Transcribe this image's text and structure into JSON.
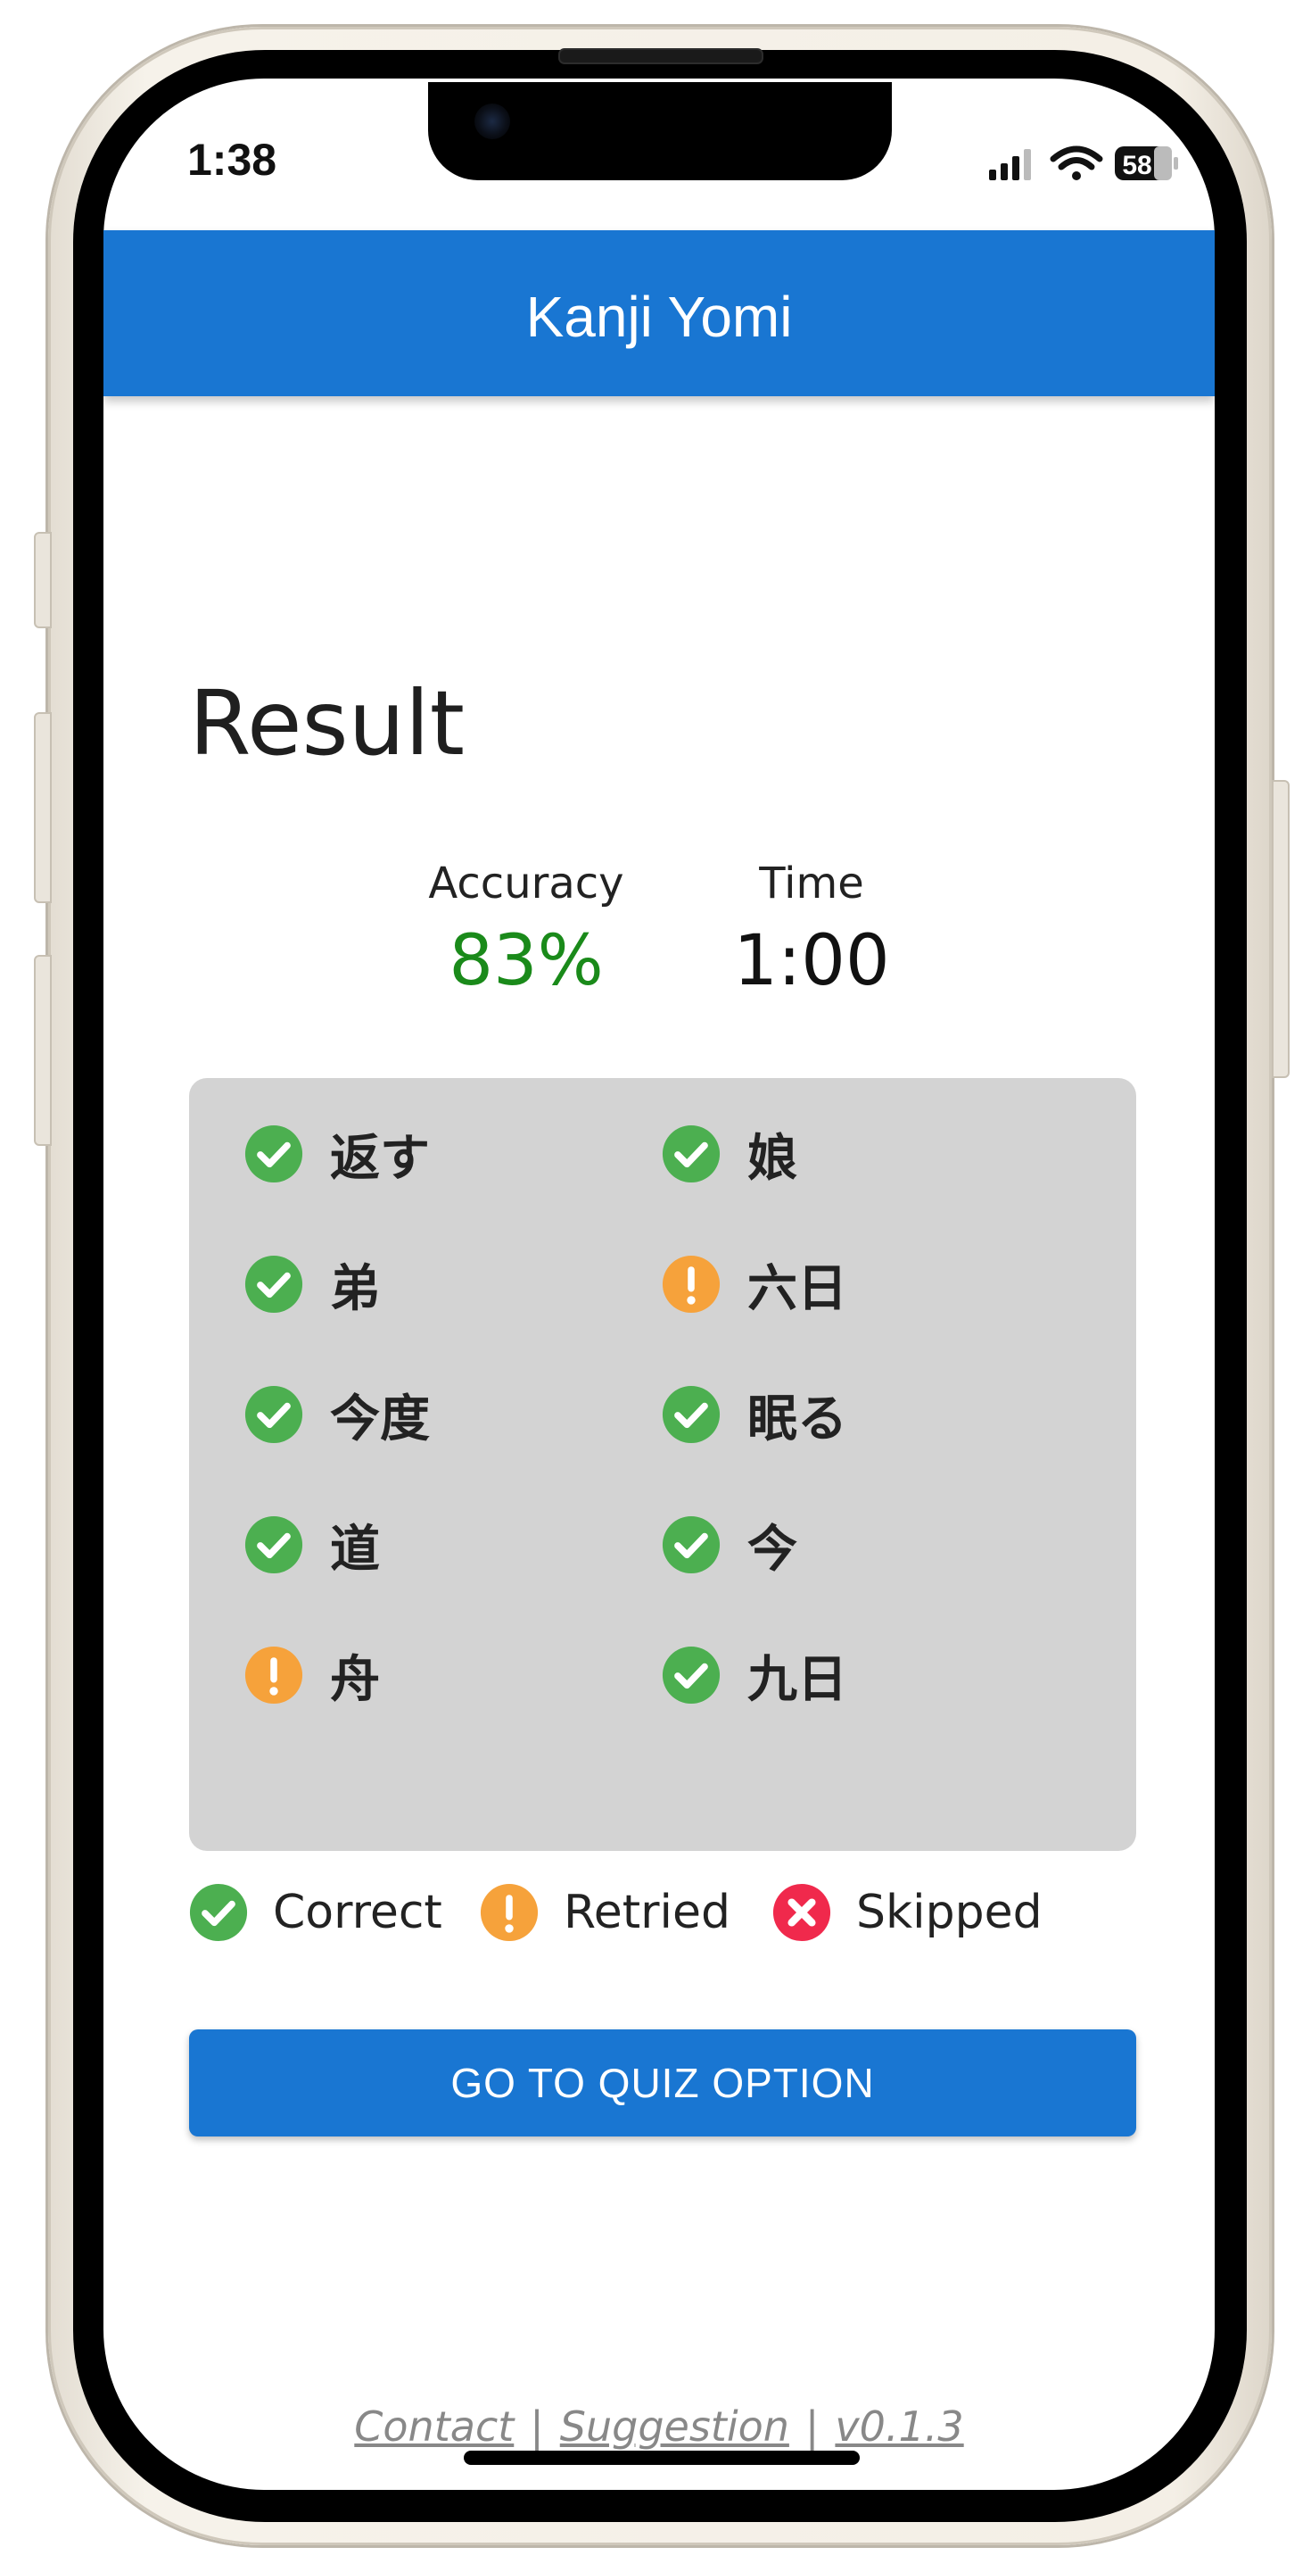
{
  "status_bar": {
    "time": "1:38",
    "battery": "58",
    "icons": [
      "cellular-signal-icon",
      "wifi-icon",
      "battery-icon"
    ]
  },
  "appbar": {
    "title": "Kanji Yomi"
  },
  "result": {
    "title": "Result",
    "accuracy_label": "Accuracy",
    "accuracy_value": "83%",
    "time_label": "Time",
    "time_value": "1:00"
  },
  "items": [
    {
      "word": "返す",
      "status": "correct"
    },
    {
      "word": "娘",
      "status": "correct"
    },
    {
      "word": "弟",
      "status": "correct"
    },
    {
      "word": "六日",
      "status": "retried"
    },
    {
      "word": "今度",
      "status": "correct"
    },
    {
      "word": "眠る",
      "status": "correct"
    },
    {
      "word": "道",
      "status": "correct"
    },
    {
      "word": "今",
      "status": "correct"
    },
    {
      "word": "舟",
      "status": "retried"
    },
    {
      "word": "九日",
      "status": "correct"
    }
  ],
  "legend": {
    "correct": "Correct",
    "retried": "Retried",
    "skipped": "Skipped"
  },
  "button": {
    "label": "GO TO QUIZ OPTION"
  },
  "footer": {
    "contact": "Contact",
    "suggestion": "Suggestion",
    "version": "v0.1.3",
    "separator": "|"
  },
  "colors": {
    "primary": "#1976d2",
    "correct": "#4caf50",
    "retried": "#f6a23b",
    "skipped": "#f0294c",
    "accuracy": "#1a8a1a"
  }
}
